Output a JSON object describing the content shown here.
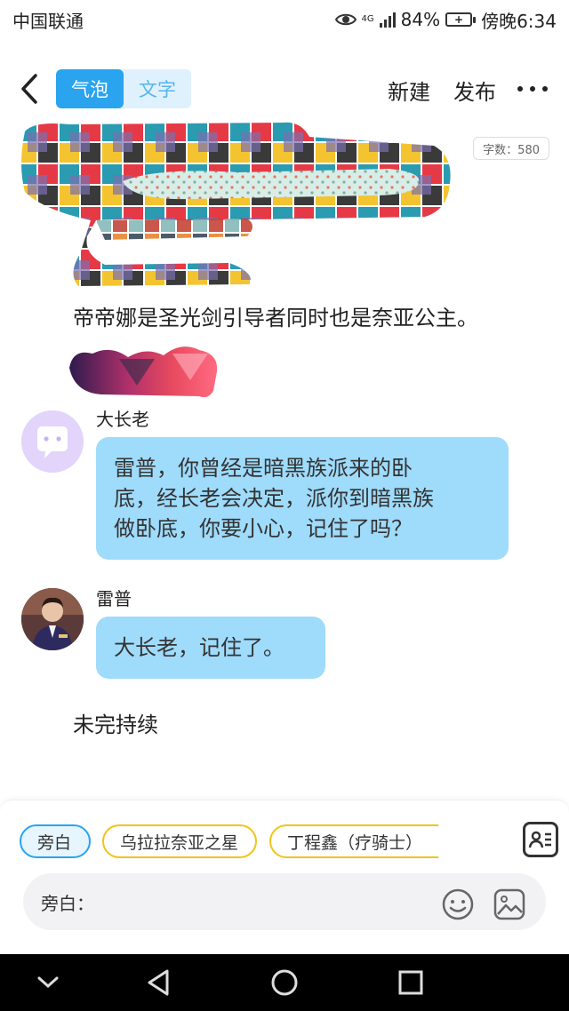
{
  "status_bar": {
    "carrier": "中国联通",
    "network": "4G",
    "battery": "84%",
    "time": "傍晚6:34"
  },
  "header": {
    "tabs": [
      {
        "label": "气泡",
        "active": true
      },
      {
        "label": "文字",
        "active": false
      }
    ],
    "new_label": "新建",
    "publish_label": "发布"
  },
  "content": {
    "word_count": "字数：580",
    "narration_1": "帝帝娜是圣光剑引导者同时也是奈亚公主。",
    "messages": [
      {
        "speaker": "大长老",
        "text_lines": [
          "雷普，你曾经是暗黑族派来的卧",
          "底，经长老会决定，派你到暗黑族",
          "做卧底，你要小心，记住了吗？"
        ]
      },
      {
        "speaker": "雷普",
        "text_lines": [
          "大长老，记住了。"
        ]
      }
    ],
    "narration_2": "未完持续"
  },
  "bottom": {
    "chips": [
      "旁白",
      "乌拉拉奈亚之星",
      "丁程鑫（疗骑士）"
    ],
    "input_label": "旁白：",
    "input_value": ""
  },
  "colors": {
    "accent": "#2aa4ef",
    "bubble": "#9fdbfb",
    "chip_border": "#f0c419"
  }
}
